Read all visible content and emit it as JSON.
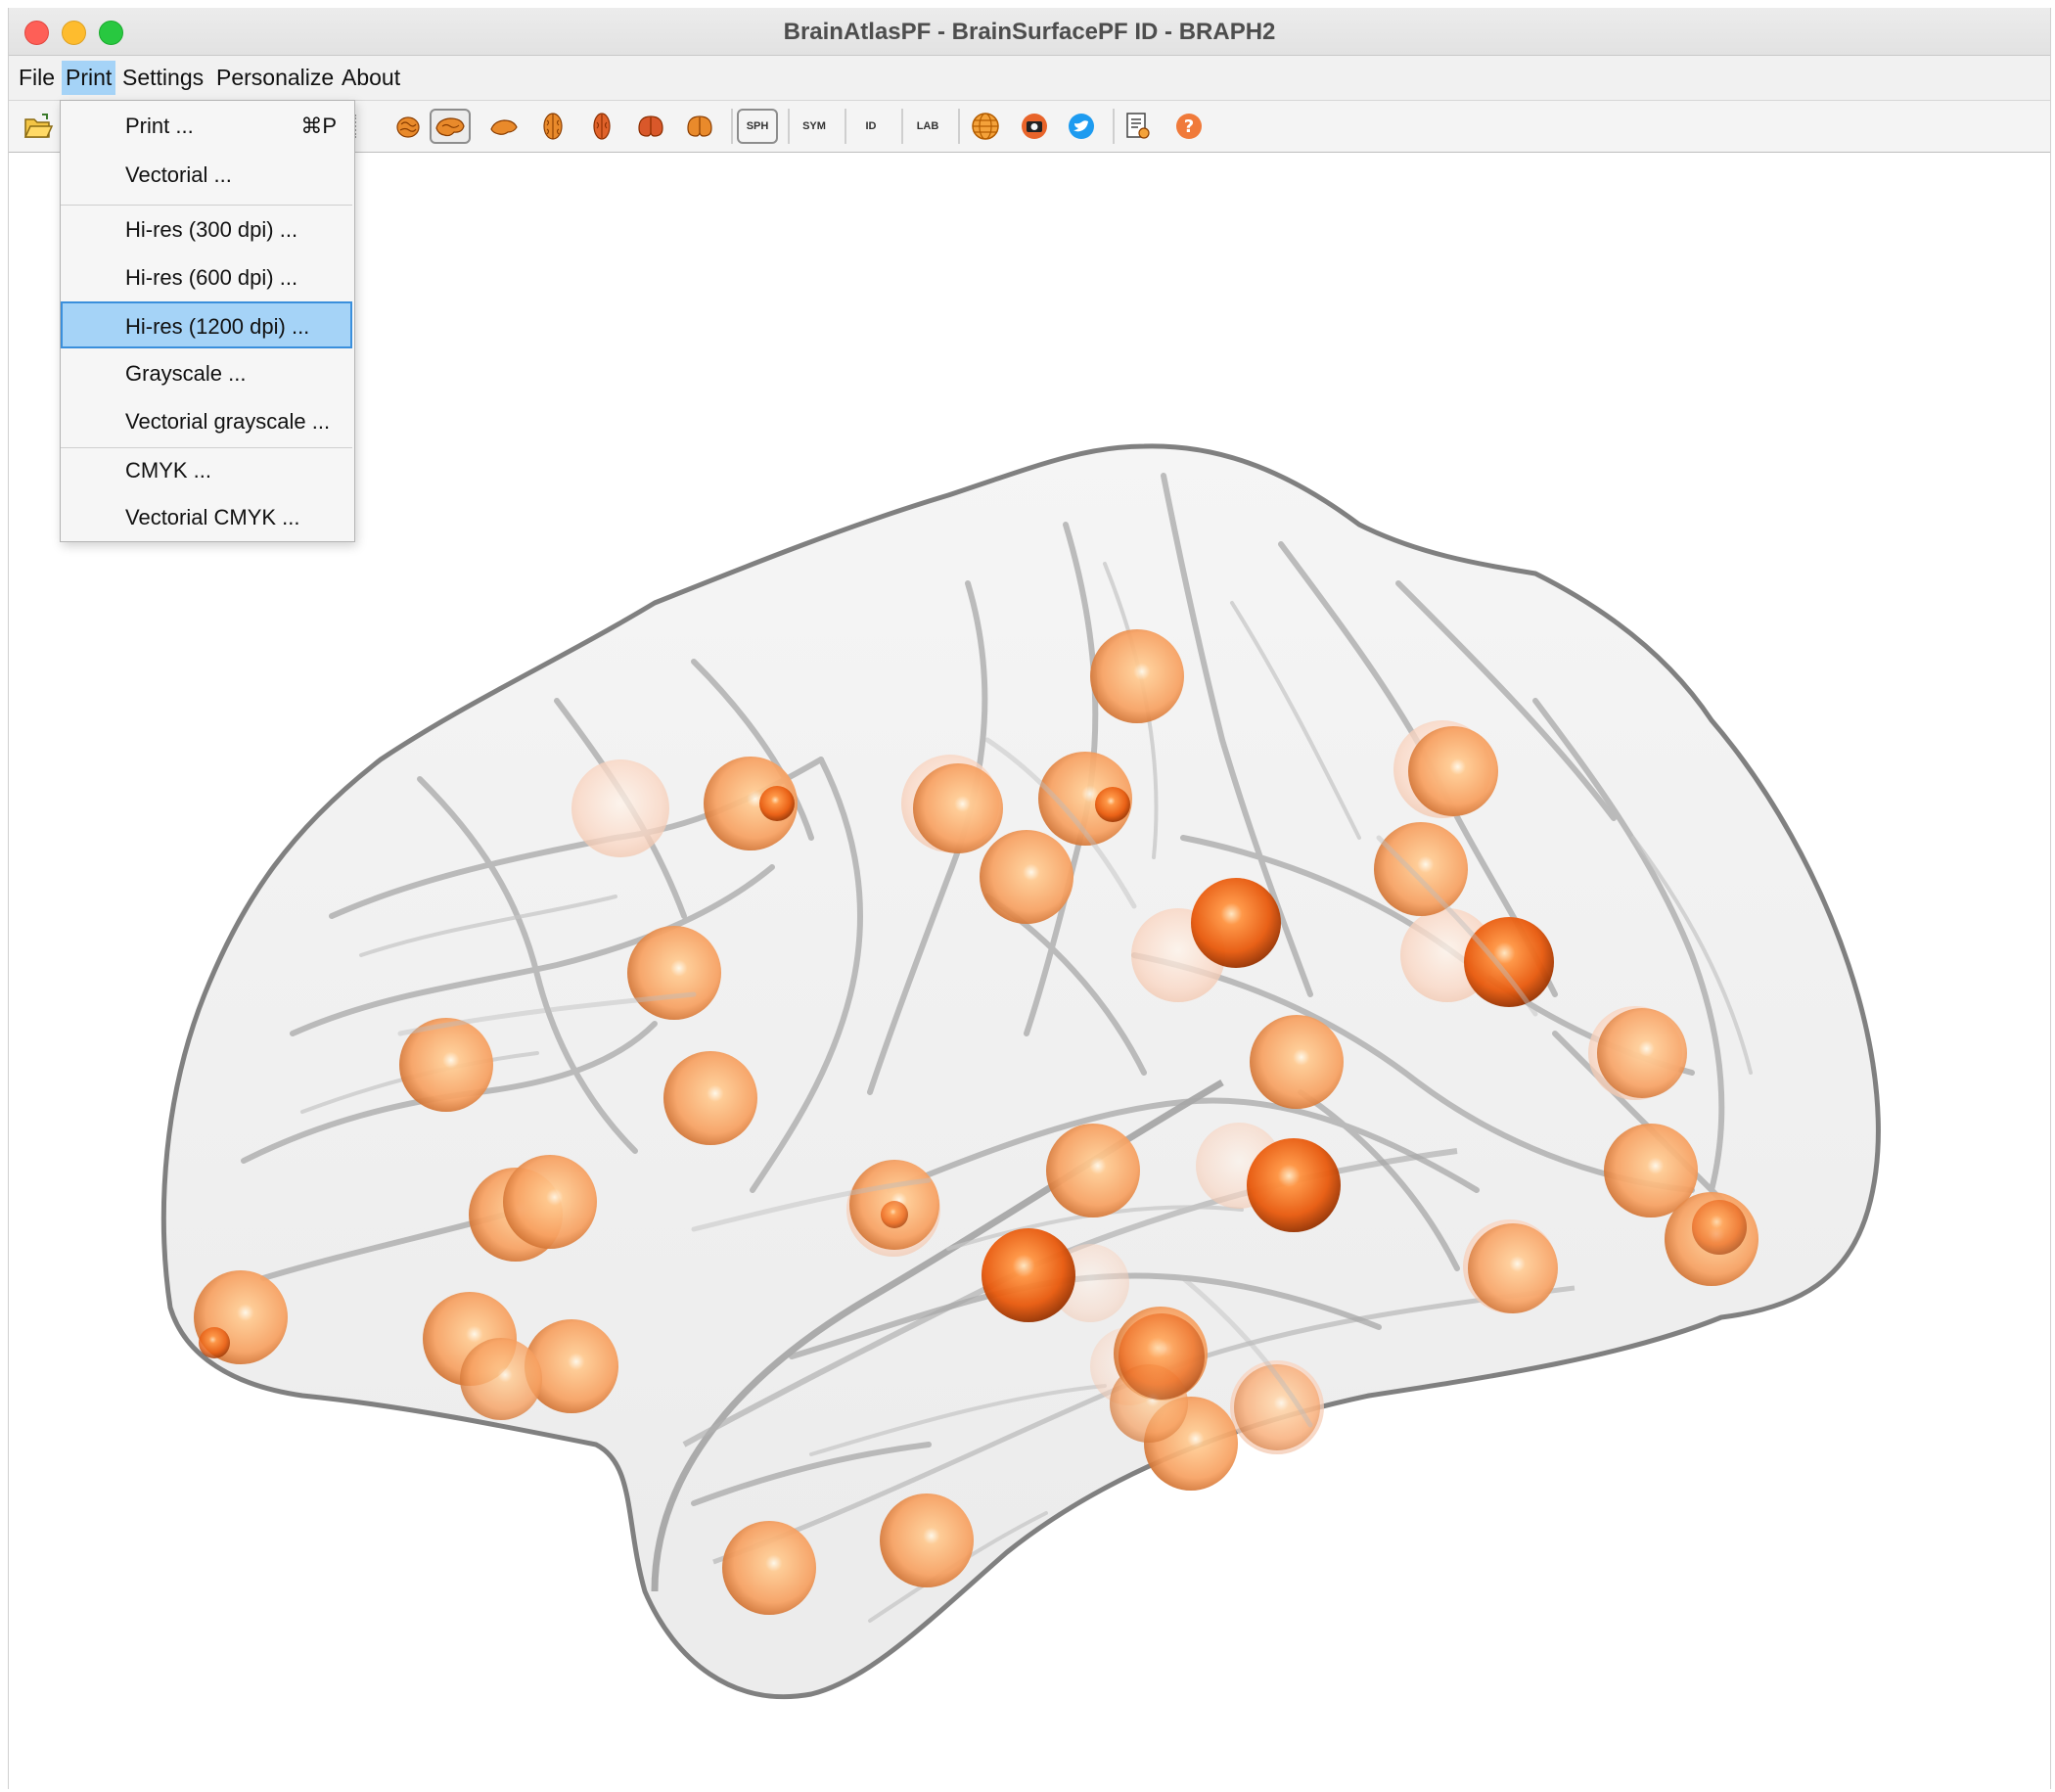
{
  "window": {
    "title": "BrainAtlasPF - BrainSurfacePF ID - BRAPH2"
  },
  "menubar": {
    "items": [
      {
        "label": "File"
      },
      {
        "label": "Print"
      },
      {
        "label": "Settings"
      },
      {
        "label": "Personalize"
      },
      {
        "label": "About"
      }
    ],
    "active": "Print"
  },
  "print_menu": {
    "items": [
      {
        "label": "Print ...",
        "shortcut": "⌘P"
      },
      {
        "label": "Vectorial ..."
      },
      {
        "label": "Hi-res (300 dpi) ..."
      },
      {
        "label": "Hi-res (600 dpi) ..."
      },
      {
        "label": "Hi-res (1200 dpi) ..."
      },
      {
        "label": "Grayscale ..."
      },
      {
        "label": "Vectorial grayscale ..."
      },
      {
        "label": "CMYK ..."
      },
      {
        "label": "Vectorial CMYK ..."
      }
    ],
    "highlighted": "Hi-res (1200 dpi) ..."
  },
  "toolbar": {
    "buttons": [
      {
        "icon": "open-folder-icon"
      },
      {
        "icon": "brain-view-3d-icon"
      },
      {
        "icon": "brain-view-left-icon",
        "pressed": true
      },
      {
        "icon": "brain-view-right-icon"
      },
      {
        "icon": "brain-view-top-icon"
      },
      {
        "icon": "brain-view-bottom-icon"
      },
      {
        "icon": "brain-view-front-icon"
      },
      {
        "icon": "brain-view-back-icon"
      },
      {
        "label": "SPH",
        "pressed": true
      },
      {
        "label": "SYM"
      },
      {
        "label": "ID"
      },
      {
        "label": "LAB"
      },
      {
        "icon": "grid-sphere-icon"
      },
      {
        "icon": "camera-icon"
      },
      {
        "icon": "info-icon"
      },
      {
        "icon": "report-icon"
      },
      {
        "icon": "help-icon"
      }
    ]
  },
  "colors": {
    "sphere": "#f7a060",
    "sphere_dark": "#e8590c",
    "highlight": "#a5d3f7",
    "highlight_border": "#3a8fdc"
  }
}
